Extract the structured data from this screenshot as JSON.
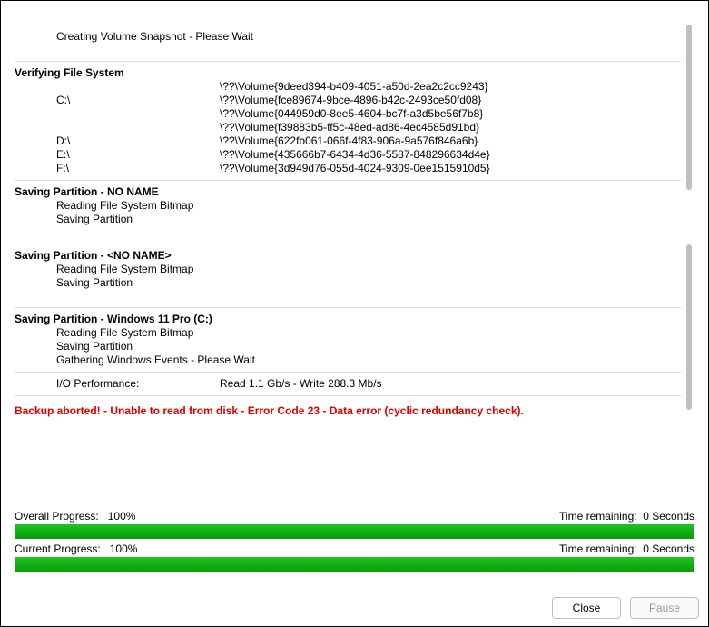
{
  "log": {
    "creating_snapshot": "Creating Volume Snapshot - Please Wait",
    "verifying_heading": "Verifying File System",
    "volumes": [
      {
        "drive": "",
        "path": "\\??\\Volume{9deed394-b409-4051-a50d-2ea2c2cc9243}"
      },
      {
        "drive": "C:\\",
        "path": "\\??\\Volume{fce89674-9bce-4896-b42c-2493ce50fd08}"
      },
      {
        "drive": "",
        "path": "\\??\\Volume{044959d0-8ee5-4604-bc7f-a3d5be56f7b8}"
      },
      {
        "drive": "",
        "path": "\\??\\Volume{f39883b5-ff5c-48ed-ad86-4ec4585d91bd}"
      },
      {
        "drive": "D:\\",
        "path": "\\??\\Volume{622fb061-066f-4f83-906a-9a576f846a6b}"
      },
      {
        "drive": "E:\\",
        "path": "\\??\\Volume{435666b7-6434-4d36-5587-848296634d4e}"
      },
      {
        "drive": "F:\\",
        "path": "\\??\\Volume{3d949d76-055d-4024-9309-0ee1515910d5}"
      }
    ],
    "sections": [
      {
        "heading": "Saving Partition - NO NAME",
        "lines": [
          "Reading File System Bitmap",
          "Saving Partition"
        ]
      },
      {
        "heading": "Saving Partition - <NO NAME>",
        "lines": [
          "Reading File System Bitmap",
          "Saving Partition"
        ]
      },
      {
        "heading": "Saving Partition - Windows 11 Pro (C:)",
        "lines": [
          "Reading File System Bitmap",
          "Saving Partition",
          "Gathering Windows Events - Please Wait"
        ]
      }
    ],
    "io_perf_label": "I/O Performance:",
    "io_perf_value": "Read 1.1 Gb/s - Write 288.3 Mb/s",
    "error": "Backup aborted! - Unable to read from disk - Error Code 23 - Data error (cyclic redundancy check)."
  },
  "progress": {
    "overall_label": "Overall Progress:",
    "overall_value": "100%",
    "overall_fill": "100%",
    "overall_time_label": "Time remaining:",
    "overall_time_value": "0 Seconds",
    "current_label": "Current Progress:",
    "current_value": "100%",
    "current_fill": "100%",
    "current_time_label": "Time remaining:",
    "current_time_value": "0 Seconds"
  },
  "buttons": {
    "close": "Close",
    "pause": "Pause"
  }
}
